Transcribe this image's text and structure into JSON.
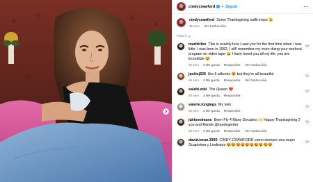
{
  "header": {
    "username": "cindycrawford",
    "follow_label": "Seguir",
    "verified_icon": "verified-badge-icon",
    "more_icon": "more-options-icon"
  },
  "caption": {
    "username": "cindycrawford",
    "text": "Some Thanksgiving outfit inspo 😉",
    "time": "36 sem",
    "translation": "Ver traducción"
  },
  "replies_label": "Para ti",
  "comments": [
    {
      "username": "marikiriko",
      "text": "This is exactly how I saw you for the first time when I was little. I was born in 1992, I still remember my mom doing your workout program on video tape 😄 I have loved you all my life, you are incredible 😍",
      "time": "36 sem",
      "likes": "3 Me gusta",
      "reply": "Responder",
      "translation": "Ver traducción"
    },
    {
      "username": "jackiej526",
      "text": "like 6 w/boots 😍 but they're all beautiful",
      "time": "36 sem",
      "likes": "2 Me gusta",
      "reply": "Responder",
      "translation": "Ver traducción"
    },
    {
      "username": "salahi.zeki",
      "text": "The Queen ❤️",
      "time": "36 sem",
      "likes": "4 Me gusta",
      "reply": "Responder",
      "translation": ""
    },
    {
      "username": "valerie.longlegs",
      "text": "My twin",
      "time": "36 sem",
      "likes": "2 Me gusta",
      "reply": "Responder",
      "translation": ""
    },
    {
      "username": "jahlovedeane",
      "text": "Been Fly 4 Many Decades 🙌 Happy Thanksgiving 2 you and Rande @randegerber",
      "time": "36 sem",
      "likes": "2 Me gusta",
      "reply": "Responder",
      "translation": "Ver traducción"
    },
    {
      "username": "david.teran.3990",
      "text": "CINDY CRAWFORD como siempre una mujer Guapisima y Lindisima 😍😍😍😍😍😍😍😍😍😍",
      "time": "36 sem",
      "likes": "",
      "reply": "",
      "translation": ""
    }
  ],
  "colors": {
    "accent": "#0095f6",
    "meta": "#737373",
    "divider": "#efefef",
    "ring": "#e1306c"
  },
  "photo": {
    "subject": "woman-with-brown-hair-black-top-jeans-on-pink-sofa",
    "next_icon": "chevron-right-icon"
  }
}
